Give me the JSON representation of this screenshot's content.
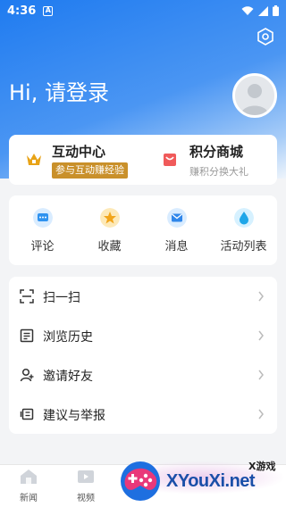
{
  "status_bar": {
    "time": "4:36",
    "notification_glyph": "A"
  },
  "header": {
    "greeting": "Hi, 请登录"
  },
  "promo": [
    {
      "title": "互动中心",
      "subtitle": "参与互动赚经验",
      "icon": "crown-icon",
      "accent": "#e8a317"
    },
    {
      "title": "积分商城",
      "subtitle": "赚积分换大礼",
      "icon": "shopping-bag-icon",
      "accent": "#f05a5a"
    }
  ],
  "quick_actions": [
    {
      "label": "评论",
      "icon": "comment-icon"
    },
    {
      "label": "收藏",
      "icon": "star-icon"
    },
    {
      "label": "消息",
      "icon": "mail-icon"
    },
    {
      "label": "活动列表",
      "icon": "drop-icon"
    }
  ],
  "menu": [
    {
      "label": "扫一扫",
      "icon": "scan-icon"
    },
    {
      "label": "浏览历史",
      "icon": "history-icon"
    },
    {
      "label": "邀请好友",
      "icon": "invite-icon"
    },
    {
      "label": "建议与举报",
      "icon": "report-icon"
    }
  ],
  "bottom_nav": [
    {
      "label": "新闻",
      "icon": "news-icon"
    },
    {
      "label": "视频",
      "icon": "video-icon"
    }
  ],
  "watermark": {
    "top": "X游戏",
    "main": "XYouXi.net"
  },
  "colors": {
    "header_blue": "#1f7bf0",
    "promo_badge": "#c9902a",
    "watermark_text": "#1a4fa8"
  }
}
